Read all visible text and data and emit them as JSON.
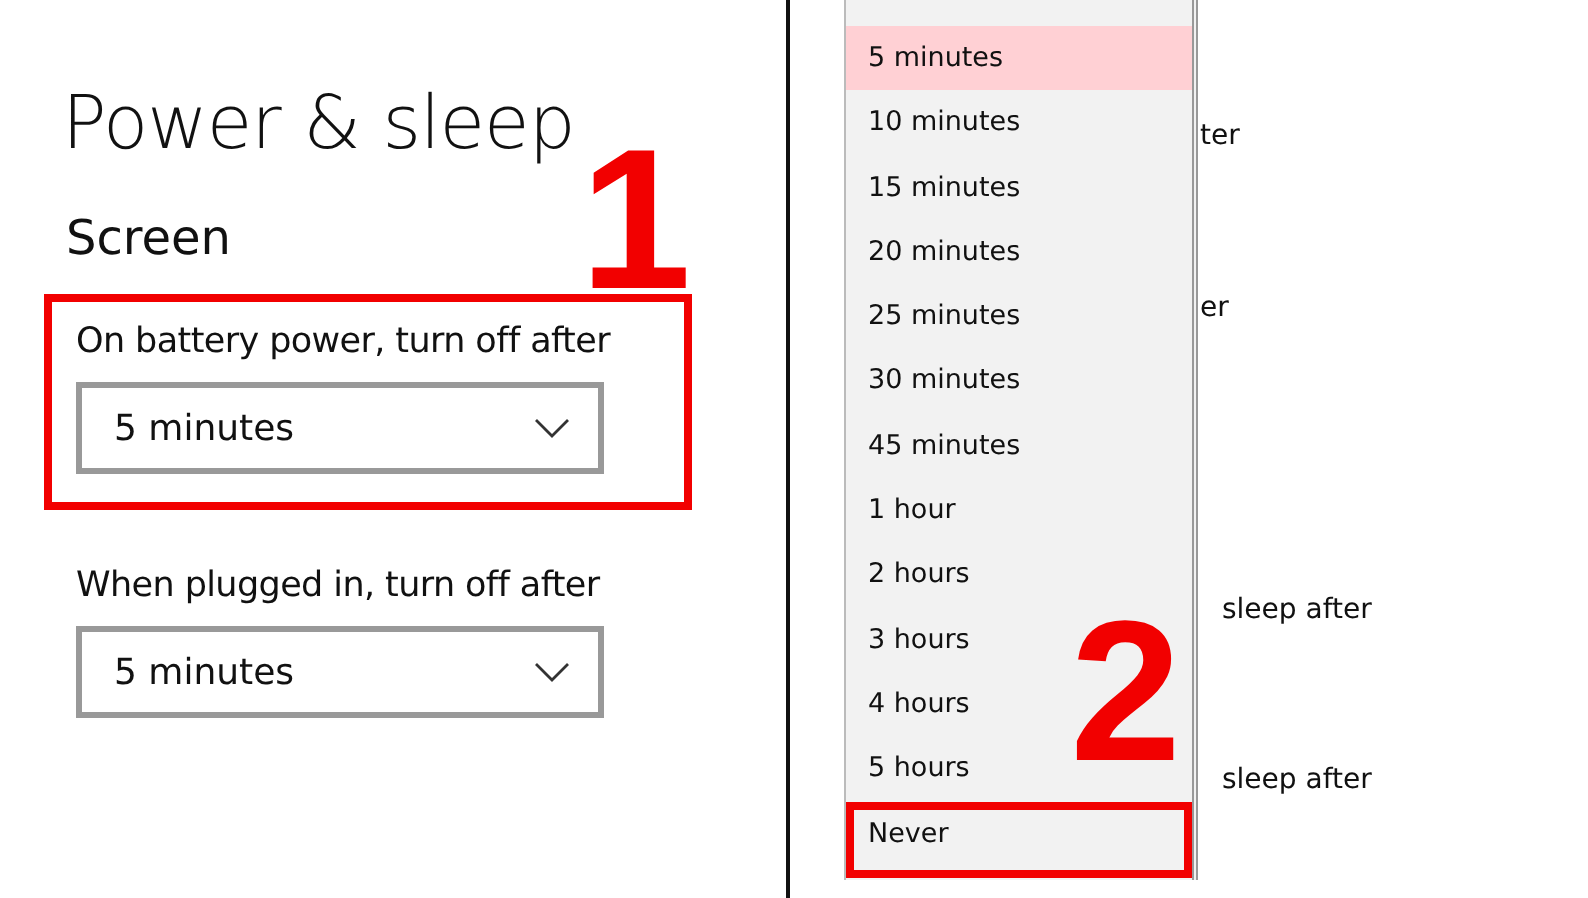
{
  "title": "Power & sleep",
  "section": "Screen",
  "settings": [
    {
      "label": "On battery power, turn off after",
      "value": "5 minutes",
      "outlined": true
    },
    {
      "label": "When plugged in, turn off after",
      "value": "5 minutes",
      "outlined": false
    }
  ],
  "step_markers": [
    "1",
    "2"
  ],
  "background_fragments": [
    "ter",
    "er",
    "sleep after",
    "sleep after"
  ],
  "dropdown": {
    "options": [
      {
        "label": "5 minutes",
        "selected": true,
        "outlined": false
      },
      {
        "label": "10 minutes",
        "selected": false,
        "outlined": false
      },
      {
        "label": "15 minutes",
        "selected": false,
        "outlined": false
      },
      {
        "label": "20 minutes",
        "selected": false,
        "outlined": false
      },
      {
        "label": "25 minutes",
        "selected": false,
        "outlined": false
      },
      {
        "label": "30 minutes",
        "selected": false,
        "outlined": false
      },
      {
        "label": "45 minutes",
        "selected": false,
        "outlined": false
      },
      {
        "label": "1 hour",
        "selected": false,
        "outlined": false
      },
      {
        "label": "2 hours",
        "selected": false,
        "outlined": false
      },
      {
        "label": "3 hours",
        "selected": false,
        "outlined": false
      },
      {
        "label": "4 hours",
        "selected": false,
        "outlined": false
      },
      {
        "label": "5 hours",
        "selected": false,
        "outlined": false
      },
      {
        "label": "Never",
        "selected": false,
        "outlined": true
      }
    ]
  }
}
